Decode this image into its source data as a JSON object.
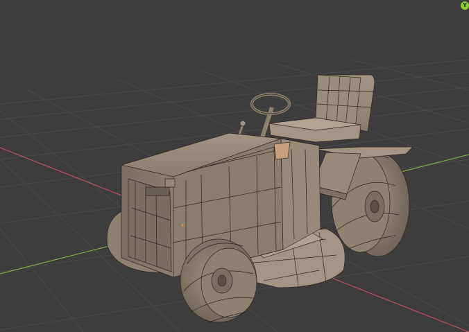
{
  "viewport": {
    "background": "#3d3d3d",
    "grid_color": "#4a4a4a",
    "x_axis_color": "#c0525f",
    "y_axis_color": "#7fb244",
    "model_base_color": "#8a7d6d",
    "wire_color": "#2a241e"
  },
  "gizmo": {
    "label": "Y",
    "color": "#8fcf2f"
  }
}
